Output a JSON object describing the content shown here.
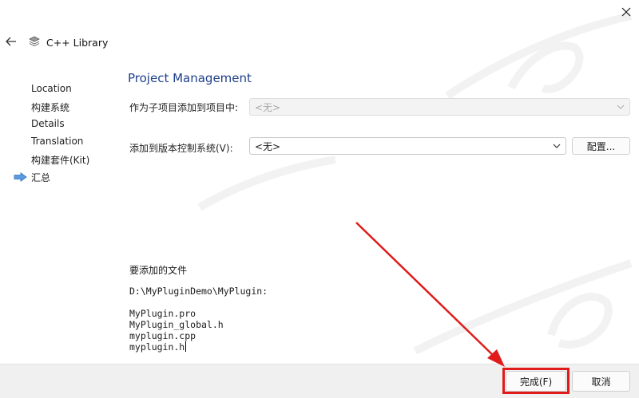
{
  "wizard": {
    "title": "C++ Library"
  },
  "steps": [
    {
      "label": "Location",
      "current": false
    },
    {
      "label": "构建系统",
      "current": false
    },
    {
      "label": "Details",
      "current": false
    },
    {
      "label": "Translation",
      "current": false
    },
    {
      "label": "构建套件(Kit)",
      "current": false
    },
    {
      "label": "汇总",
      "current": true
    }
  ],
  "page": {
    "title": "Project Management"
  },
  "form": {
    "subproject_label": "作为子项目添加到项目中:",
    "subproject_value": "<无>",
    "vcs_label": "添加到版本控制系统(V):",
    "vcs_value": "<无>",
    "configure_label": "配置..."
  },
  "files": {
    "header": "要添加的文件",
    "directory": "D:\\MyPluginDemo\\MyPlugin:",
    "list": [
      "MyPlugin.pro",
      "MyPlugin_global.h",
      "myplugin.cpp",
      "myplugin.h"
    ]
  },
  "footer": {
    "finish_label": "完成(F)",
    "cancel_label": "取消"
  },
  "colors": {
    "accent_title": "#1f3f8c",
    "annotation_red": "#e01b1b",
    "step_arrow": "#4a90d9"
  },
  "icons": [
    "close-icon",
    "back-arrow-icon",
    "layers-icon",
    "current-step-arrow-icon",
    "chevron-down-icon"
  ]
}
